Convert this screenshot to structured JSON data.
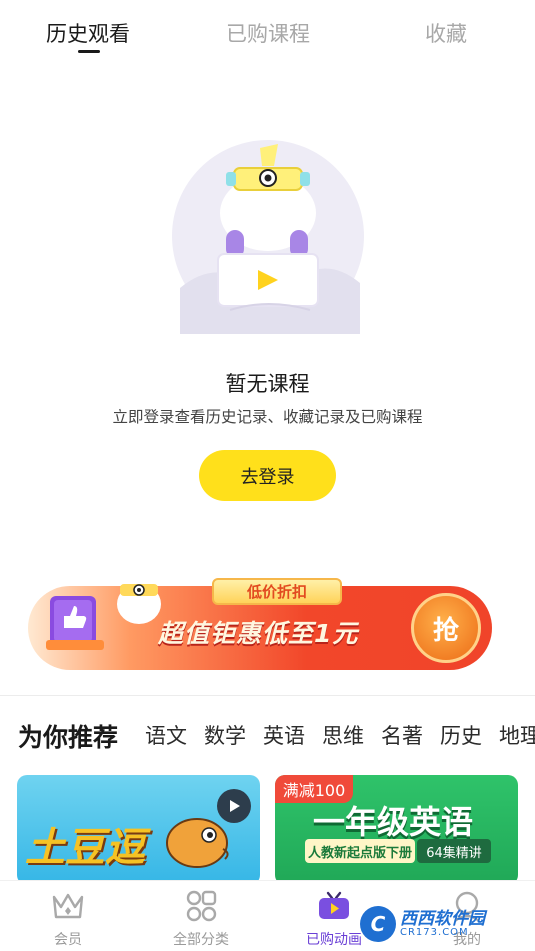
{
  "tabs": [
    {
      "label": "历史观看",
      "active": true
    },
    {
      "label": "已购课程",
      "active": false
    },
    {
      "label": "收藏",
      "active": false
    }
  ],
  "empty_state": {
    "title": "暂无课程",
    "subtitle": "立即登录查看历史记录、收藏记录及已购课程",
    "button_label": "去登录"
  },
  "banner": {
    "tag": "低价折扣",
    "text": "超值钜惠低至1元",
    "grab_label": "抢"
  },
  "recommend": {
    "title": "为你推荐",
    "categories": [
      "语文",
      "数学",
      "英语",
      "思维",
      "名著",
      "历史",
      "地理"
    ]
  },
  "cards": [
    {
      "title": "土豆逗"
    },
    {
      "badge": "满减100",
      "title": "一年级英语",
      "sub1": "人教新起点版下册",
      "sub2": "64集精讲"
    }
  ],
  "bottom_nav": [
    {
      "label": "会员",
      "icon": "crown-icon",
      "active": false
    },
    {
      "label": "全部分类",
      "icon": "category-grid-icon",
      "active": false
    },
    {
      "label": "已购动画",
      "icon": "tv-icon",
      "active": true
    },
    {
      "label": "我的",
      "icon": "profile-icon",
      "active": false
    }
  ],
  "watermark": {
    "main": "西西软件园",
    "sub": "CR173.COM",
    "logo": "C"
  },
  "colors": {
    "accent_yellow": "#ffe01b",
    "active_purple": "#6a3fd6",
    "banner_red": "#f0442a"
  }
}
